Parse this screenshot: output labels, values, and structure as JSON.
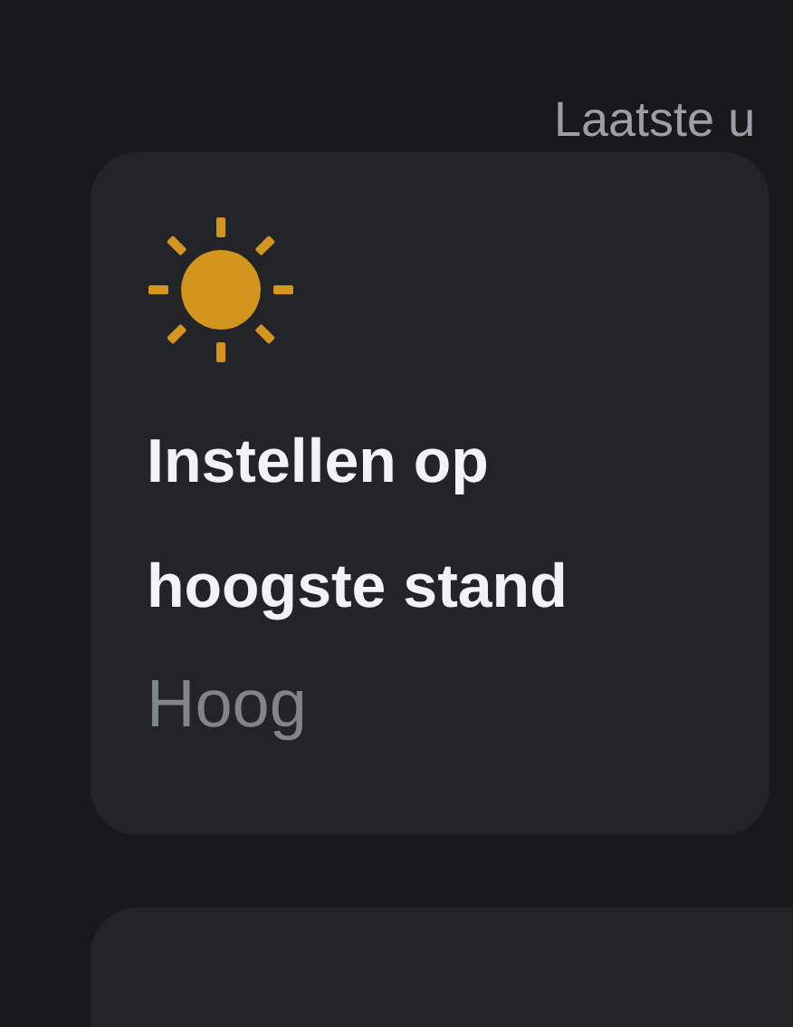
{
  "header": {
    "text": "Laatste u"
  },
  "card": {
    "title": "Instellen op hoogste stand",
    "subtitle": "Hoog"
  }
}
